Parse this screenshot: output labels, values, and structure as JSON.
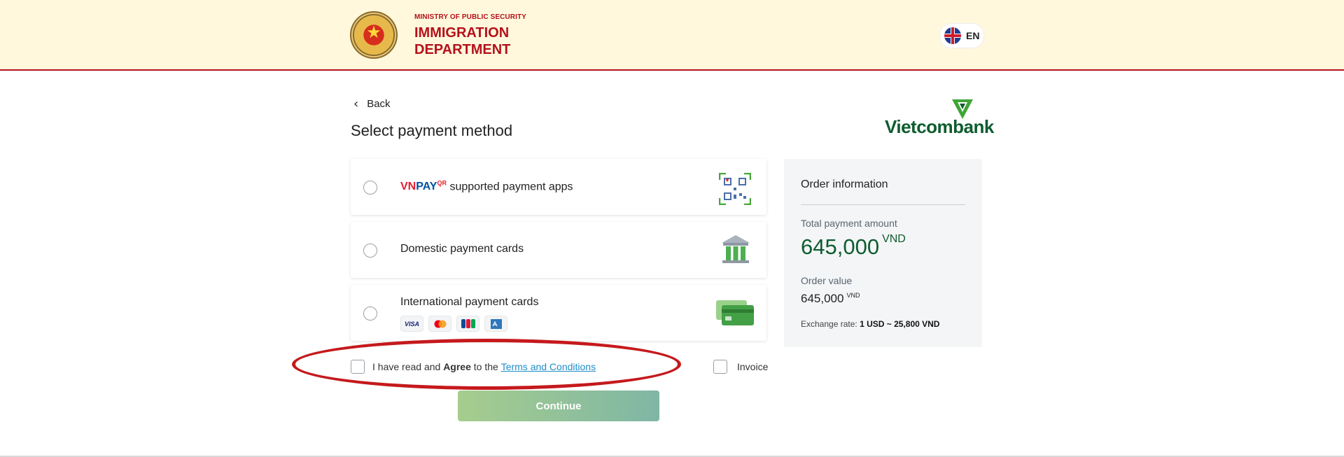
{
  "header": {
    "ministry": "MINISTRY OF PUBLIC SECURITY",
    "department_line1": "IMMIGRATION",
    "department_line2": "DEPARTMENT",
    "language": "EN"
  },
  "nav": {
    "back_label": "Back"
  },
  "page": {
    "title": "Select payment method"
  },
  "bank": {
    "name": "Vietcombank"
  },
  "payment_methods": {
    "vnpay": {
      "brand_vn": "VN",
      "brand_pay": "PAY",
      "brand_qr": "QR",
      "label": "supported payment apps"
    },
    "domestic": {
      "label": "Domestic payment cards"
    },
    "international": {
      "label": "International payment cards",
      "cards": [
        "VISA",
        "Mastercard",
        "JCB",
        "AMEX"
      ]
    }
  },
  "order": {
    "heading": "Order information",
    "total_label": "Total payment amount",
    "total_value": "645,000",
    "total_currency": "VND",
    "order_value_label": "Order value",
    "order_value": "645,000",
    "order_value_currency": "VND",
    "exchange_prefix": "Exchange rate: ",
    "exchange_value": "1 USD ~ 25,800 VND"
  },
  "agreement": {
    "prefix": "I have read and ",
    "bold": "Agree",
    "middle": " to the ",
    "link": "Terms and Conditions"
  },
  "invoice": {
    "label": "Invoice"
  },
  "continue_label": "Continue",
  "colors": {
    "brand_red": "#b4121b",
    "vcb_green": "#0f5c2f",
    "link_blue": "#1f8ec9"
  }
}
